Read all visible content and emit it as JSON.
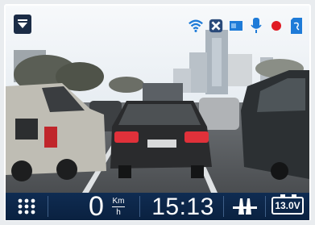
{
  "speed": {
    "value": "0",
    "unit_top": "Km",
    "unit_bottom": "h"
  },
  "clock": {
    "time": "15:13"
  },
  "battery": {
    "voltage": "13.0V"
  },
  "status_icons": [
    "wifi-icon",
    "bluetooth-off-icon",
    "speaker-icon",
    "microphone-icon",
    "record-dot-icon",
    "sd-card-icon"
  ],
  "colors": {
    "toolbar": "#0f2c52",
    "record": "#e01b24",
    "accent": "#1e7bd8"
  }
}
